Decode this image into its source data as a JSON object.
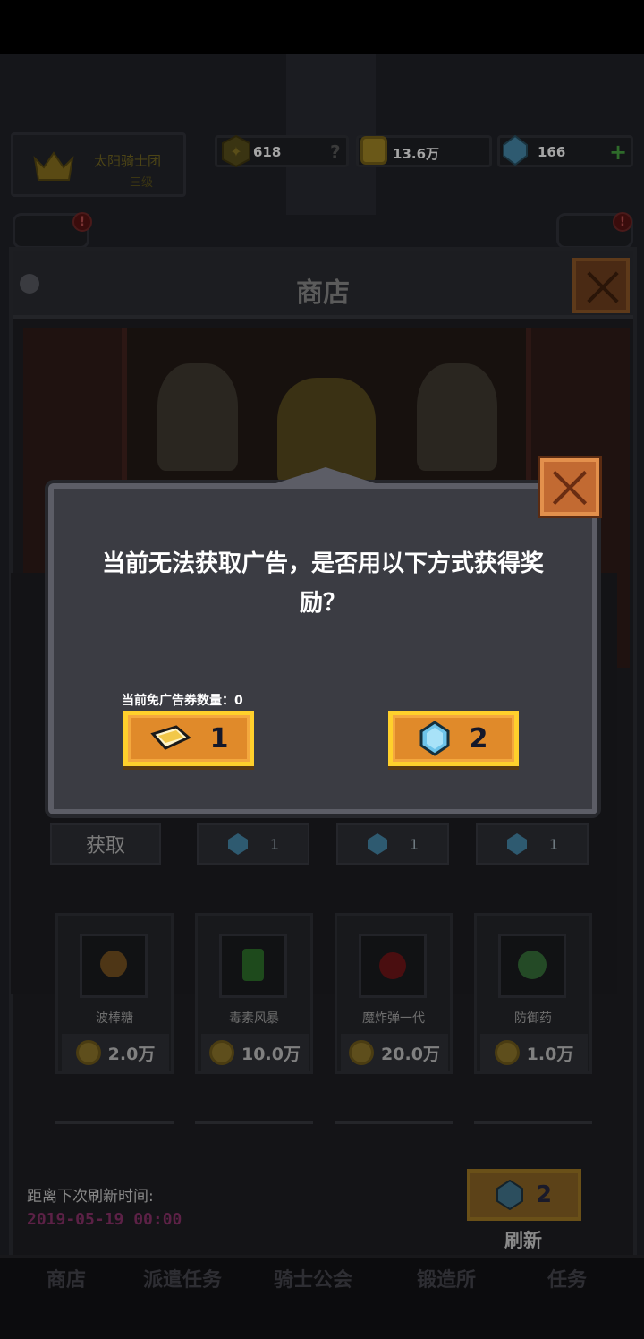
{
  "top_bar": {
    "guild_name": "太阳骑士团",
    "guild_level": "三级",
    "power": "618",
    "power_help": "?",
    "gold": "13.6万",
    "gems": "166",
    "gems_add": "+"
  },
  "badges": {
    "left": "!",
    "right": "!"
  },
  "shop": {
    "title": "商店",
    "tabs": [
      {
        "label": "获取"
      },
      {
        "value": "1"
      },
      {
        "value": "1"
      },
      {
        "value": "1"
      }
    ],
    "items": [
      {
        "name": "波棒糖",
        "price": "2.0万"
      },
      {
        "name": "毒素风暴",
        "price": "10.0万"
      },
      {
        "name": "魔炸弹一代",
        "price": "20.0万"
      },
      {
        "name": "防御药",
        "price": "1.0万"
      }
    ],
    "refresh_label": "距离下次刷新时间:",
    "refresh_time": "2019-05-19 00:00",
    "refresh_cost": "2",
    "refresh_button": "刷新"
  },
  "bottom_nav": [
    "商店",
    "派遣任务",
    "骑士公会",
    "锻造所",
    "任务"
  ],
  "dialog": {
    "message": "当前无法获取广告，是否用以下方式获得奖励？",
    "ticket_count_label": "当前免广告券数量：0",
    "ticket_option_value": "1",
    "gem_option_value": "2"
  },
  "colors": {
    "button_orange": "#e08a2a",
    "button_border": "#ffd02c",
    "dialog_bg": "#3b3c43",
    "close_red": "#c26a32",
    "refresh_time": "#5c2146"
  }
}
